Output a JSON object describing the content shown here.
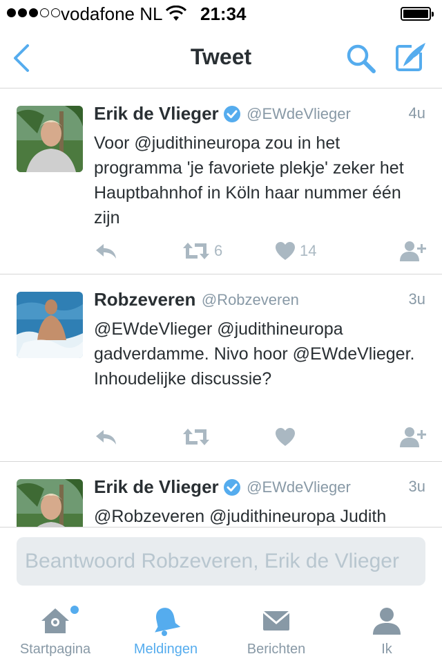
{
  "status_bar": {
    "carrier": "vodafone NL",
    "time": "21:34",
    "signal_bars_filled": 3,
    "signal_bars_total": 5,
    "battery_level": 1.0
  },
  "nav": {
    "title": "Tweet",
    "back_icon": "chevron-left-icon",
    "search_icon": "search-icon",
    "compose_icon": "compose-feather-icon",
    "accent_color": "#55acee"
  },
  "tweets": [
    {
      "name": "Erik de Vlieger",
      "verified": true,
      "handle": "@EWdeVlieger",
      "time": "4u",
      "text": "Voor @judithineuropa zou in het programma 'je favoriete plekje' zeker het Hauptbahnhof in Köln haar nummer één zijn",
      "retweets": "6",
      "likes": "14"
    },
    {
      "name": "Robzeveren",
      "verified": false,
      "handle": "@Robzeveren",
      "time": "3u",
      "text": "@EWdeVlieger @judithineuropa gadverdamme. Nivo hoor @EWdeVlieger. Inhoudelijke discussie?",
      "retweets": "",
      "likes": ""
    },
    {
      "name": "Erik de Vlieger",
      "verified": true,
      "handle": "@EWdeVlieger",
      "time": "3u",
      "text": "@Robzeveren @judithineuropa Judith",
      "retweets": "",
      "likes": ""
    }
  ],
  "reply": {
    "placeholder": "Beantwoord Robzeveren, Erik de Vlieger"
  },
  "tabs": [
    {
      "label": "Startpagina",
      "icon": "home-icon",
      "active": false,
      "has_notification_dot": true
    },
    {
      "label": "Meldingen",
      "icon": "bell-icon",
      "active": true,
      "has_notification_dot": false
    },
    {
      "label": "Berichten",
      "icon": "envelope-icon",
      "active": false,
      "has_notification_dot": false
    },
    {
      "label": "Ik",
      "icon": "person-icon",
      "active": false,
      "has_notification_dot": false
    }
  ]
}
